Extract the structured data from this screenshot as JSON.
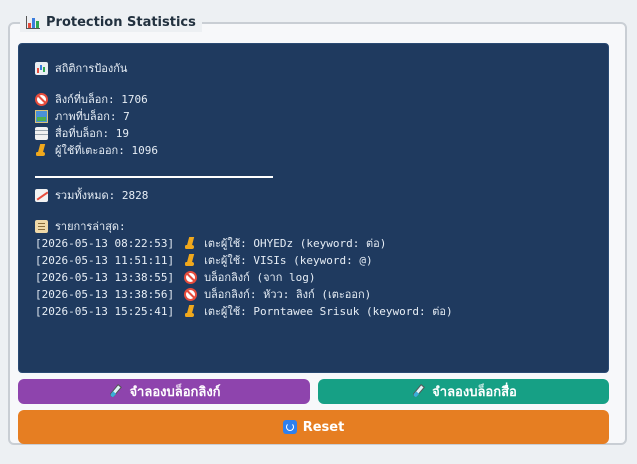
{
  "legend": {
    "title": "Protection Statistics"
  },
  "stats": {
    "heading": "สถิติการป้องกัน",
    "rows": [
      "ลิงก์ที่บล็อก: 1706",
      "ภาพที่บล็อก: 7",
      "สื่อที่บล็อก: 19",
      "ผู้ใช้ที่เตะออก: 1096"
    ],
    "total": "รวมทั้งหมด: 2828",
    "recent_heading": "รายการล่าสุด:"
  },
  "log": [
    {
      "time": "[2026-05-13 08:22:53]",
      "icon": "boot-icon",
      "text": "เตะผู้ใช้: OHYEDz (keyword: ต่อ)"
    },
    {
      "time": "[2026-05-13 11:51:11]",
      "icon": "boot-icon",
      "text": "เตะผู้ใช้: VISIs (keyword: @)"
    },
    {
      "time": "[2026-05-13 13:38:55]",
      "icon": "ban-icon",
      "text": "บล็อกลิงก์ (จาก log)"
    },
    {
      "time": "[2026-05-13 13:38:56]",
      "icon": "ban-icon",
      "text": "บล็อกลิงก์: หัวว: ลิงก์ (เตะออก)"
    },
    {
      "time": "[2026-05-13 15:25:41]",
      "icon": "boot-icon",
      "text": "เตะผู้ใช้: Porntawee Srisuk (keyword: ต่อ)"
    }
  ],
  "buttons": {
    "simulate_link": "จำลองบล็อกลิงก์",
    "simulate_media": "จำลองบล็อกสื่อ",
    "reset": "Reset"
  },
  "colors": {
    "panel_bg": "#1f3a5f",
    "purple": "#8e44ad",
    "teal": "#16a085",
    "orange": "#e67e22"
  }
}
